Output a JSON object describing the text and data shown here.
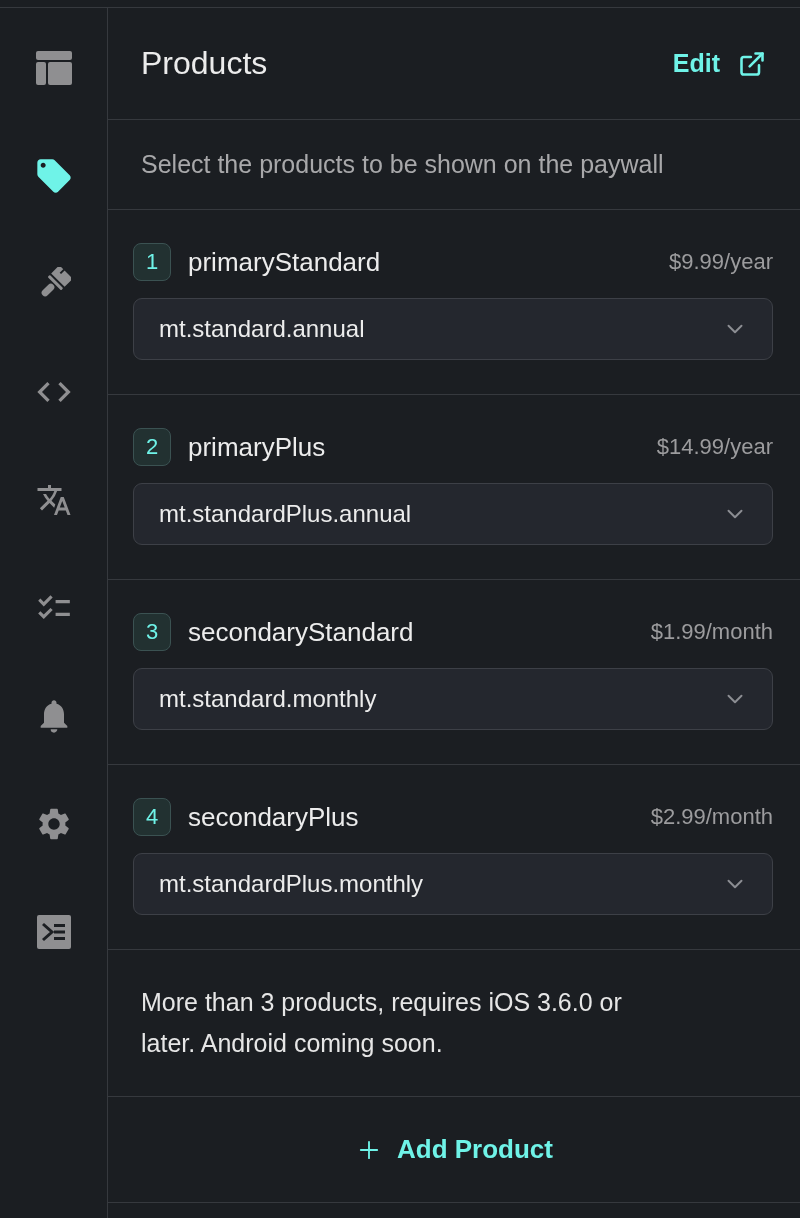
{
  "sidebar": {
    "items": [
      {
        "selected": false
      },
      {
        "selected": true
      },
      {
        "selected": false
      },
      {
        "selected": false
      },
      {
        "selected": false
      },
      {
        "selected": false
      },
      {
        "selected": false
      },
      {
        "selected": false
      },
      {
        "selected": false
      }
    ]
  },
  "panel": {
    "title": "Products",
    "edit_link": "Edit",
    "description": "Select the products to be shown on the paywall",
    "products": [
      {
        "number": "1",
        "name": "primaryStandard",
        "price": "$9.99/year",
        "product_id": "mt.standard.annual"
      },
      {
        "number": "2",
        "name": "primaryPlus",
        "price": "$14.99/year",
        "product_id": "mt.standardPlus.annual"
      },
      {
        "number": "3",
        "name": "secondaryStandard",
        "price": "$1.99/month",
        "product_id": "mt.standard.monthly"
      },
      {
        "number": "4",
        "name": "secondaryPlus",
        "price": "$2.99/month",
        "product_id": "mt.standardPlus.monthly"
      }
    ],
    "note": "More than 3 products, requires iOS 3.6.0 or later. Android coming soon.",
    "add_button": "Add Product"
  }
}
